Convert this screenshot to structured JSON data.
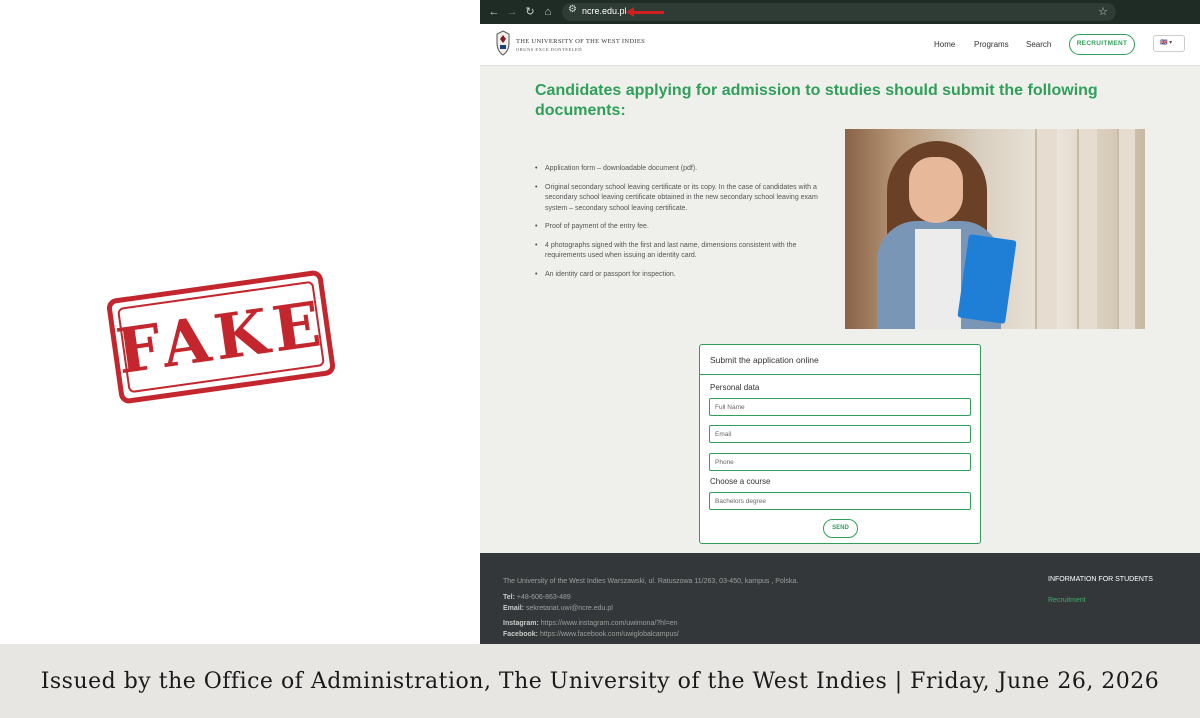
{
  "stamp": {
    "text": "FAKE"
  },
  "browser": {
    "url": "ncre.edu.pl"
  },
  "header": {
    "logo_title": "THE UNIVERSITY OF THE WEST INDIES",
    "logo_subtitle": "ORUNS EXCE DONTEELED",
    "nav": [
      "Home",
      "Programs",
      "Search"
    ],
    "recruitment_label": "RECRUITMENT",
    "language": "🇬🇧 ▾"
  },
  "main": {
    "heading": "Candidates applying for admission to studies should submit the following documents:",
    "documents": [
      "Application form – downloadable document (pdf).",
      "Original secondary school leaving certificate or its copy. In the case of candidates with a secondary school leaving certificate obtained in the new secondary school leaving exam system – secondary school leaving certificate.",
      "Proof of payment of the entry fee.",
      "4 photographs signed with the first and last name, dimensions consistent with the requirements used when issuing an identity card.",
      "An identity card or passport for inspection."
    ]
  },
  "form": {
    "title": "Submit the application online",
    "personal_label": "Personal data",
    "fullname_placeholder": "Full Name",
    "email_placeholder": "Email",
    "phone_placeholder": "Phone",
    "course_label": "Choose a course",
    "course_value": "Bachelors degree",
    "send_label": "SEND"
  },
  "footer": {
    "address": "The University of the West Indies Warszawski, ul. Ratuszowa 11/263, 03-450, kampus , Polska.",
    "tel_label": "Tel:",
    "tel": "+48-606-863-489",
    "email_label": "Email:",
    "email": "sekretariat.uwi@ncre.edu.pl",
    "instagram_label": "Instagram:",
    "instagram": "https://www.instagram.com/uwimona/?hl=en",
    "facebook_label": "Facebook:",
    "facebook": "https://www.facebook.com/uwiglobalcampus/",
    "info_heading": "INFORMATION FOR STUDENTS",
    "info_link": "Recruitment"
  },
  "caption": "Issued by the Office of Administration, The University of the West Indies | Friday, June 26, 2026"
}
